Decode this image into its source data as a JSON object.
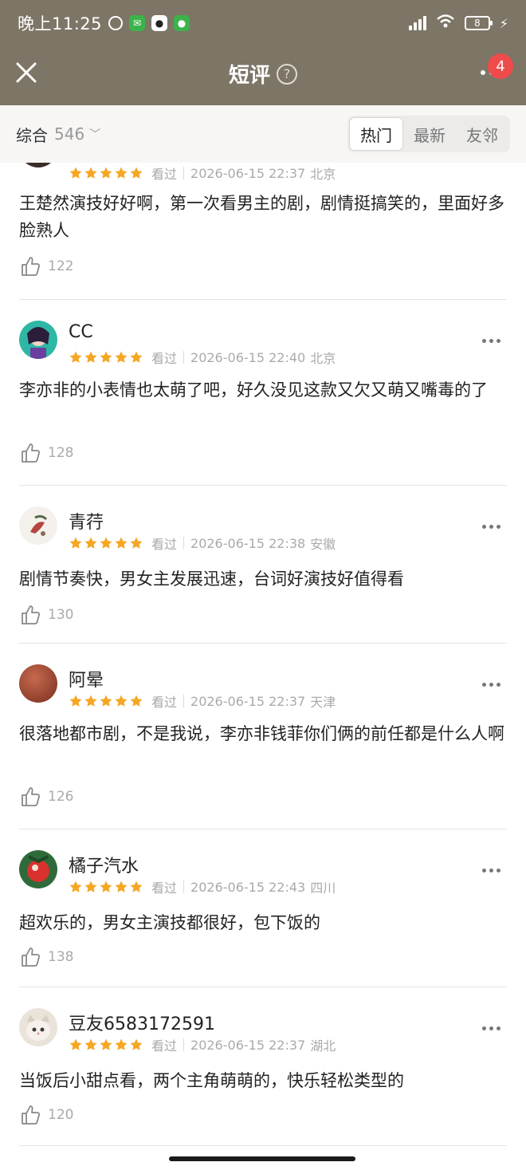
{
  "status_bar": {
    "time": "晚上11:25",
    "battery": "8",
    "icons": [
      "clock-icon",
      "wechat-icon",
      "qq-icon",
      "app-notification-icon"
    ]
  },
  "header": {
    "title": "短评",
    "help": "?",
    "badge_count": "4"
  },
  "filter": {
    "sort_label": "综合",
    "count": "546",
    "tabs": [
      "热门",
      "最新",
      "友邻"
    ],
    "active_tab": "热门"
  },
  "reviews": [
    {
      "user": "",
      "rating": 5,
      "watched": "看过",
      "time": "2026-06-15 22:37",
      "location": "北京",
      "content": "王楚然演技好好啊，第一次看男主的剧，剧情挺搞笑的，里面好多脸熟人",
      "likes": "122"
    },
    {
      "user": "CC",
      "rating": 5,
      "watched": "看过",
      "time": "2026-06-15 22:40",
      "location": "北京",
      "content": "李亦非的小表情也太萌了吧，好久没见这款又欠又萌又嘴毒的了",
      "likes": "128"
    },
    {
      "user": "青荇",
      "rating": 5,
      "watched": "看过",
      "time": "2026-06-15 22:38",
      "location": "安徽",
      "content": "剧情节奏快，男女主发展迅速，台词好演技好值得看",
      "likes": "130"
    },
    {
      "user": "阿晕",
      "rating": 5,
      "watched": "看过",
      "time": "2026-06-15 22:37",
      "location": "天津",
      "content": "很落地都市剧，不是我说，李亦非钱菲你们俩的前任都是什么人啊",
      "likes": "126"
    },
    {
      "user": "橘子汽水",
      "rating": 5,
      "watched": "看过",
      "time": "2026-06-15 22:43",
      "location": "四川",
      "content": "超欢乐的，男女主演技都很好，包下饭的",
      "likes": "138"
    },
    {
      "user": "豆友6583172591",
      "rating": 5,
      "watched": "看过",
      "time": "2026-06-15 22:37",
      "location": "湖北",
      "content": "当饭后小甜点看，两个主角萌萌的，快乐轻松类型的",
      "likes": "120"
    }
  ],
  "colors": {
    "header_bg": "#7d7566",
    "star": "#f5a623",
    "badge": "#f04b4b"
  }
}
